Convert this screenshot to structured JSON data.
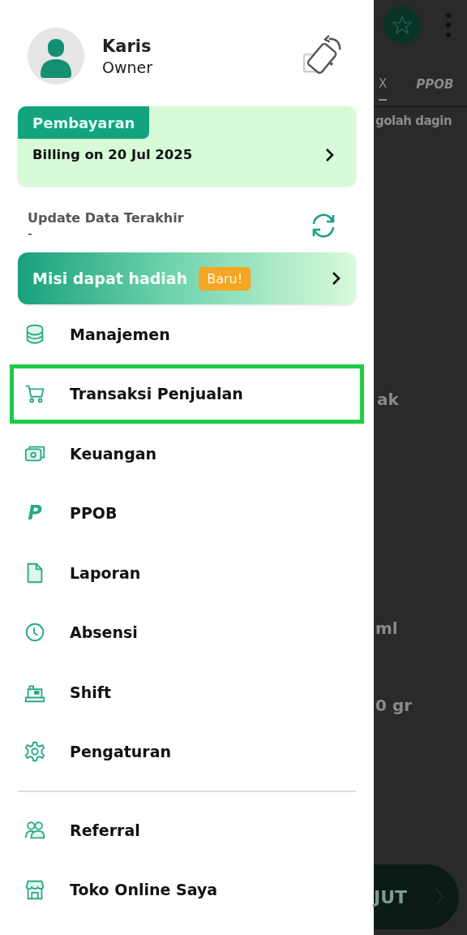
{
  "background": {
    "tabs": [
      {
        "label": "X",
        "selected": true
      },
      {
        "label": "PPOB",
        "selected": false
      }
    ],
    "texts": [
      "golah dagin",
      "ak",
      "ml",
      "0 gr"
    ],
    "button": {
      "label": "JUT"
    }
  },
  "profile": {
    "name": "Karis",
    "role": "Owner"
  },
  "billing": {
    "tag": "Pembayaran",
    "text": "Billing on 20 Jul 2025"
  },
  "update": {
    "label": "Update Data Terakhir",
    "value": "-"
  },
  "mission": {
    "text": "Misi dapat hadiah",
    "badge": "Baru!"
  },
  "menu": [
    {
      "label": "Manajemen",
      "highlighted": false
    },
    {
      "label": "Transaksi Penjualan",
      "highlighted": true
    },
    {
      "label": "Keuangan",
      "highlighted": false
    },
    {
      "label": "PPOB",
      "glyph": "P",
      "highlighted": false
    },
    {
      "label": "Laporan",
      "highlighted": false
    },
    {
      "label": "Absensi",
      "highlighted": false
    },
    {
      "label": "Shift",
      "highlighted": false
    },
    {
      "label": "Pengaturan",
      "highlighted": false
    }
  ],
  "extra_menu": [
    {
      "label": "Referral",
      "highlighted": false
    },
    {
      "label": "Toko Online Saya",
      "highlighted": false
    }
  ]
}
